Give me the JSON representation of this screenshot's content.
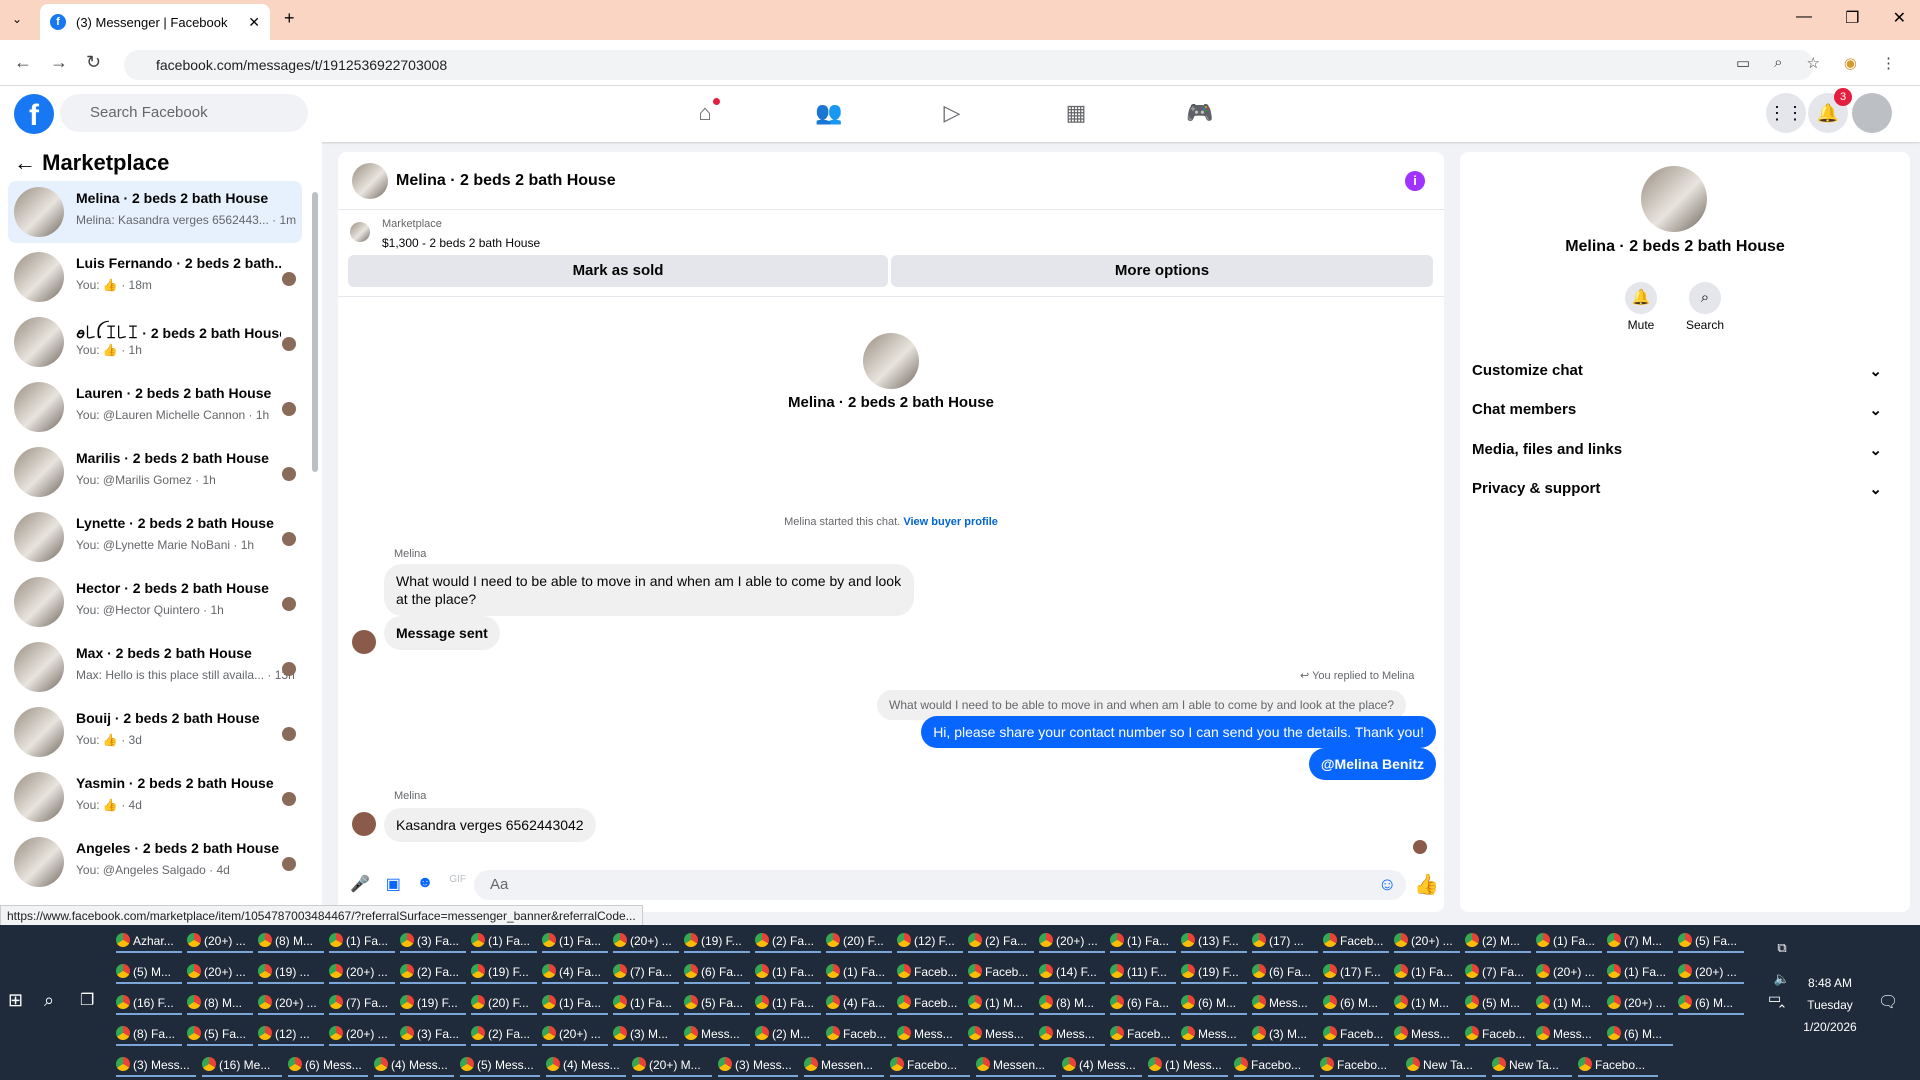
{
  "browser": {
    "tab_title": "(3) Messenger | Facebook",
    "url": "facebook.com/messages/t/1912536922703008",
    "status_url": "https://www.facebook.com/marketplace/item/1054787003484467/?referralSurface=messenger_banner&referralCode..."
  },
  "fb": {
    "search_placeholder": "Search Facebook",
    "notif_count": "3"
  },
  "sidebar": {
    "title": "Marketplace",
    "items": [
      {
        "name": "Melina · 2 beds 2 bath House",
        "snippet": "Melina: Kasandra verges 6562443... · 1m"
      },
      {
        "name": "Luis Fernando · 2 beds 2 bath...",
        "snippet": "You: 👍 · 18m"
      },
      {
        "name": "ꪮ꒒ꪶ ꀤ꒒ꀤ · 2 beds 2 bath House",
        "snippet": "You: 👍 · 1h"
      },
      {
        "name": "Lauren · 2 beds 2 bath House",
        "snippet": "You: @Lauren Michelle Cannon · 1h"
      },
      {
        "name": "Marilis · 2 beds 2 bath House",
        "snippet": "You: @Marilis Gomez · 1h"
      },
      {
        "name": "Lynette · 2 beds 2 bath House",
        "snippet": "You: @Lynette Marie NoBani · 1h"
      },
      {
        "name": "Hector · 2 beds 2 bath House",
        "snippet": "You: @Hector Quintero · 1h"
      },
      {
        "name": "Max · 2 beds 2 bath House",
        "snippet": "Max: Hello is this place still availa... · 13h"
      },
      {
        "name": "Bouij · 2 beds 2 bath House",
        "snippet": "You: 👍 · 3d"
      },
      {
        "name": "Yasmin · 2 beds 2 bath House",
        "snippet": "You: 👍 · 4d"
      },
      {
        "name": "Angeles · 2 beds 2 bath House",
        "snippet": "You: @Angeles Salgado · 4d"
      }
    ]
  },
  "chat": {
    "title": "Melina · 2 beds 2 bath House",
    "listing_label": "Marketplace",
    "listing_price": "$1,300 - 2 beds 2 bath House",
    "mark_sold": "Mark as sold",
    "more_options": "More options",
    "center_name": "Melina · 2 beds 2 bath House",
    "started_text": "Melina started this chat.",
    "view_profile": "View buyer profile",
    "sender1": "Melina",
    "msg1": "What would I need to be able to move in and when am I able to come by and look at the place?",
    "msg2": "Message sent",
    "replied_to": "You replied to Melina",
    "quoted": "What would I need to be able to move in and when am I able to come by and look at the place?",
    "out1": "Hi, please share your contact number so I can send you the details. Thank you!",
    "out2": "@Melina Benitz",
    "sender2": "Melina",
    "msg3": "Kasandra verges 6562443042",
    "composer": "Aa"
  },
  "info": {
    "name": "Melina · 2 beds 2 bath House",
    "mute": "Mute",
    "search": "Search",
    "sections": [
      "Customize chat",
      "Chat members",
      "Media, files and links",
      "Privacy & support"
    ]
  },
  "taskbar": {
    "row1": [
      "Azhar...",
      "(20+) ...",
      "(8) M...",
      "(1) Fa...",
      "(3) Fa...",
      "(1) Fa...",
      "(1) Fa...",
      "(20+) ...",
      "(19) F...",
      "(2) Fa...",
      "(20) F...",
      "(12) F...",
      "(2) Fa...",
      "(20+) ...",
      "(1) Fa...",
      "(13) F...",
      "(17) ...",
      "Faceb...",
      "(20+) ...",
      "(2) M...",
      "(1) Fa...",
      "(7) M...",
      "(5) Fa..."
    ],
    "row2": [
      "(5) M...",
      "(20+) ...",
      "(19) ...",
      "(20+) ...",
      "(2) Fa...",
      "(19) F...",
      "(4) Fa...",
      "(7) Fa...",
      "(6) Fa...",
      "(1) Fa...",
      "(1) Fa...",
      "Faceb...",
      "Faceb...",
      "(14) F...",
      "(11) F...",
      "(19) F...",
      "(6) Fa...",
      "(17) F...",
      "(1) Fa...",
      "(7) Fa...",
      "(20+) ...",
      "(1) Fa...",
      "(20+) ..."
    ],
    "row3": [
      "(16) F...",
      "(8) M...",
      "(20+) ...",
      "(7) Fa...",
      "(19) F...",
      "(20) F...",
      "(1) Fa...",
      "(1) Fa...",
      "(5) Fa...",
      "(1) Fa...",
      "(4) Fa...",
      "Faceb...",
      "(1) M...",
      "(8) M...",
      "(6) Fa...",
      "(6) M...",
      "Mess...",
      "(6) M...",
      "(1) M...",
      "(5) M...",
      "(1) M...",
      "(20+) ...",
      "(6) M..."
    ],
    "row4": [
      "(8) Fa...",
      "(5) Fa...",
      "(12) ...",
      "(20+) ...",
      "(3) Fa...",
      "(2) Fa...",
      "(20+) ...",
      "(3) M...",
      "Mess...",
      "(2) M...",
      "Faceb...",
      "Mess...",
      "Mess...",
      "Mess...",
      "Faceb...",
      "Mess...",
      "(3) M...",
      "Faceb...",
      "Mess...",
      "Faceb...",
      "Mess...",
      "(6) M..."
    ],
    "row5": [
      "(3) Mess...",
      "(16) Me...",
      "(6) Mess...",
      "(4) Mess...",
      "(5) Mess...",
      "(4) Mess...",
      "(20+) M...",
      "(3) Mess...",
      "Messen...",
      "Facebo...",
      "Messen...",
      "(4) Mess...",
      "(1) Mess...",
      "Facebo...",
      "Facebo...",
      "New Ta...",
      "New Ta...",
      "Facebo..."
    ],
    "time": "8:48 AM",
    "day": "Tuesday",
    "date": "1/20/2026"
  }
}
